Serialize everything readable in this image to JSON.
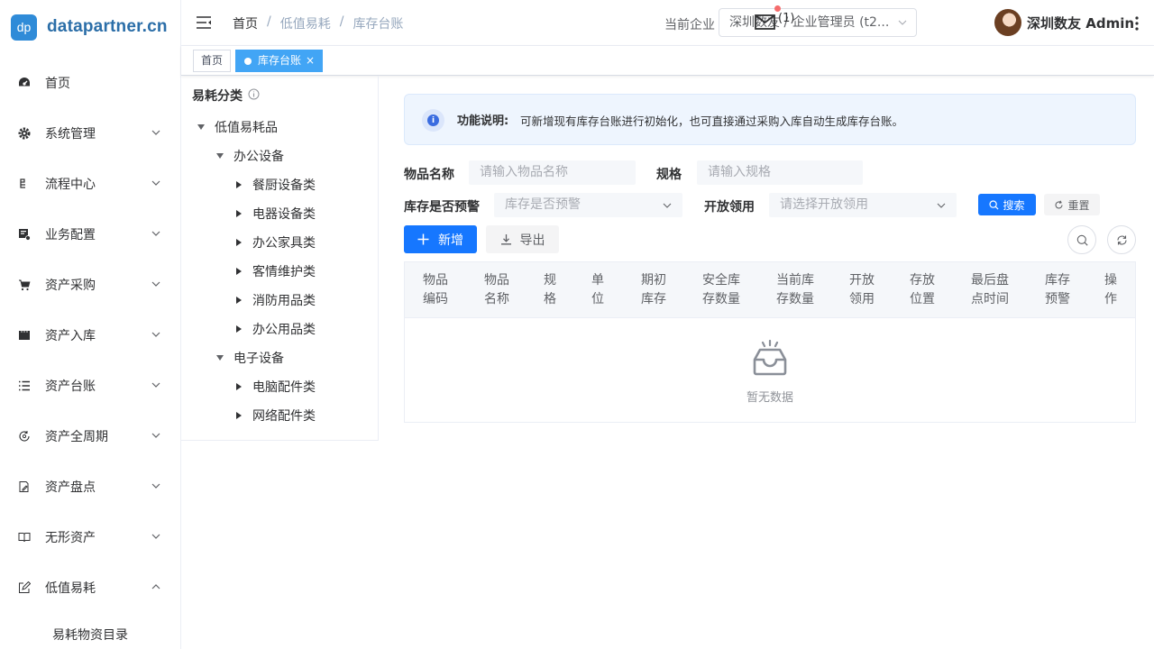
{
  "brand": {
    "badge": "dp",
    "name": "datapartner.cn"
  },
  "sidebar": {
    "items": [
      {
        "label": "首页",
        "icon": "dashboard-icon"
      },
      {
        "label": "系统管理",
        "icon": "gear-icon"
      },
      {
        "label": "流程中心",
        "icon": "flow-icon"
      },
      {
        "label": "业务配置",
        "icon": "config-icon"
      },
      {
        "label": "资产采购",
        "icon": "cart-icon"
      },
      {
        "label": "资产入库",
        "icon": "storage-icon"
      },
      {
        "label": "资产台账",
        "icon": "list-icon"
      },
      {
        "label": "资产全周期",
        "icon": "cycle-icon"
      },
      {
        "label": "资产盘点",
        "icon": "edit-doc-icon"
      },
      {
        "label": "无形资产",
        "icon": "book-icon"
      },
      {
        "label": "低值易耗",
        "icon": "pencil-box-icon"
      }
    ],
    "sub_item": "易耗物资目录"
  },
  "header": {
    "breadcrumb": [
      "首页",
      "低值易耗",
      "库存台账"
    ],
    "company_label": "当前企业",
    "company_value": "深圳数友 / 企业管理员 (t2...",
    "mail_count": "(1)",
    "username": "深圳数友 Admin"
  },
  "tags": [
    {
      "label": "首页"
    },
    {
      "label": "库存台账",
      "close": "×"
    }
  ],
  "tree": {
    "title": "易耗分类",
    "nodes": [
      {
        "label": "低值易耗品"
      },
      {
        "label": "办公设备"
      },
      {
        "label": "餐厨设备类"
      },
      {
        "label": "电器设备类"
      },
      {
        "label": "办公家具类"
      },
      {
        "label": "客情维护类"
      },
      {
        "label": "消防用品类"
      },
      {
        "label": "办公用品类"
      },
      {
        "label": "电子设备"
      },
      {
        "label": "电脑配件类"
      },
      {
        "label": "网络配件类"
      }
    ]
  },
  "notice": {
    "title": "功能说明:",
    "text": "可新增现有库存台账进行初始化，也可直接通过采购入库自动生成库存台账。"
  },
  "filters": {
    "item_name_label": "物品名称",
    "item_name_placeholder": "请输入物品名称",
    "spec_label": "规格",
    "spec_placeholder": "请输入规格",
    "warning_label": "库存是否预警",
    "warning_placeholder": "库存是否预警",
    "open_label": "开放领用",
    "open_placeholder": "请选择开放领用",
    "search_btn": "搜索",
    "reset_btn": "重置"
  },
  "toolbar": {
    "add_btn": "新增",
    "export_btn": "导出"
  },
  "table": {
    "columns": [
      [
        "物品",
        "编码"
      ],
      [
        "物品",
        "名称"
      ],
      [
        "规",
        "格"
      ],
      [
        "单",
        "位"
      ],
      [
        "期初",
        "库存"
      ],
      [
        "安全库",
        "存数量"
      ],
      [
        "当前库",
        "存数量"
      ],
      [
        "开放",
        "领用"
      ],
      [
        "存放",
        "位置"
      ],
      [
        "最后盘",
        "点时间"
      ],
      [
        "库存",
        "预警"
      ],
      [
        "操",
        "作"
      ]
    ],
    "empty_text": "暂无数据"
  },
  "colors": {
    "primary": "#1677ff",
    "tag_active": "#42a5f5",
    "badge": "#f56c6c"
  }
}
